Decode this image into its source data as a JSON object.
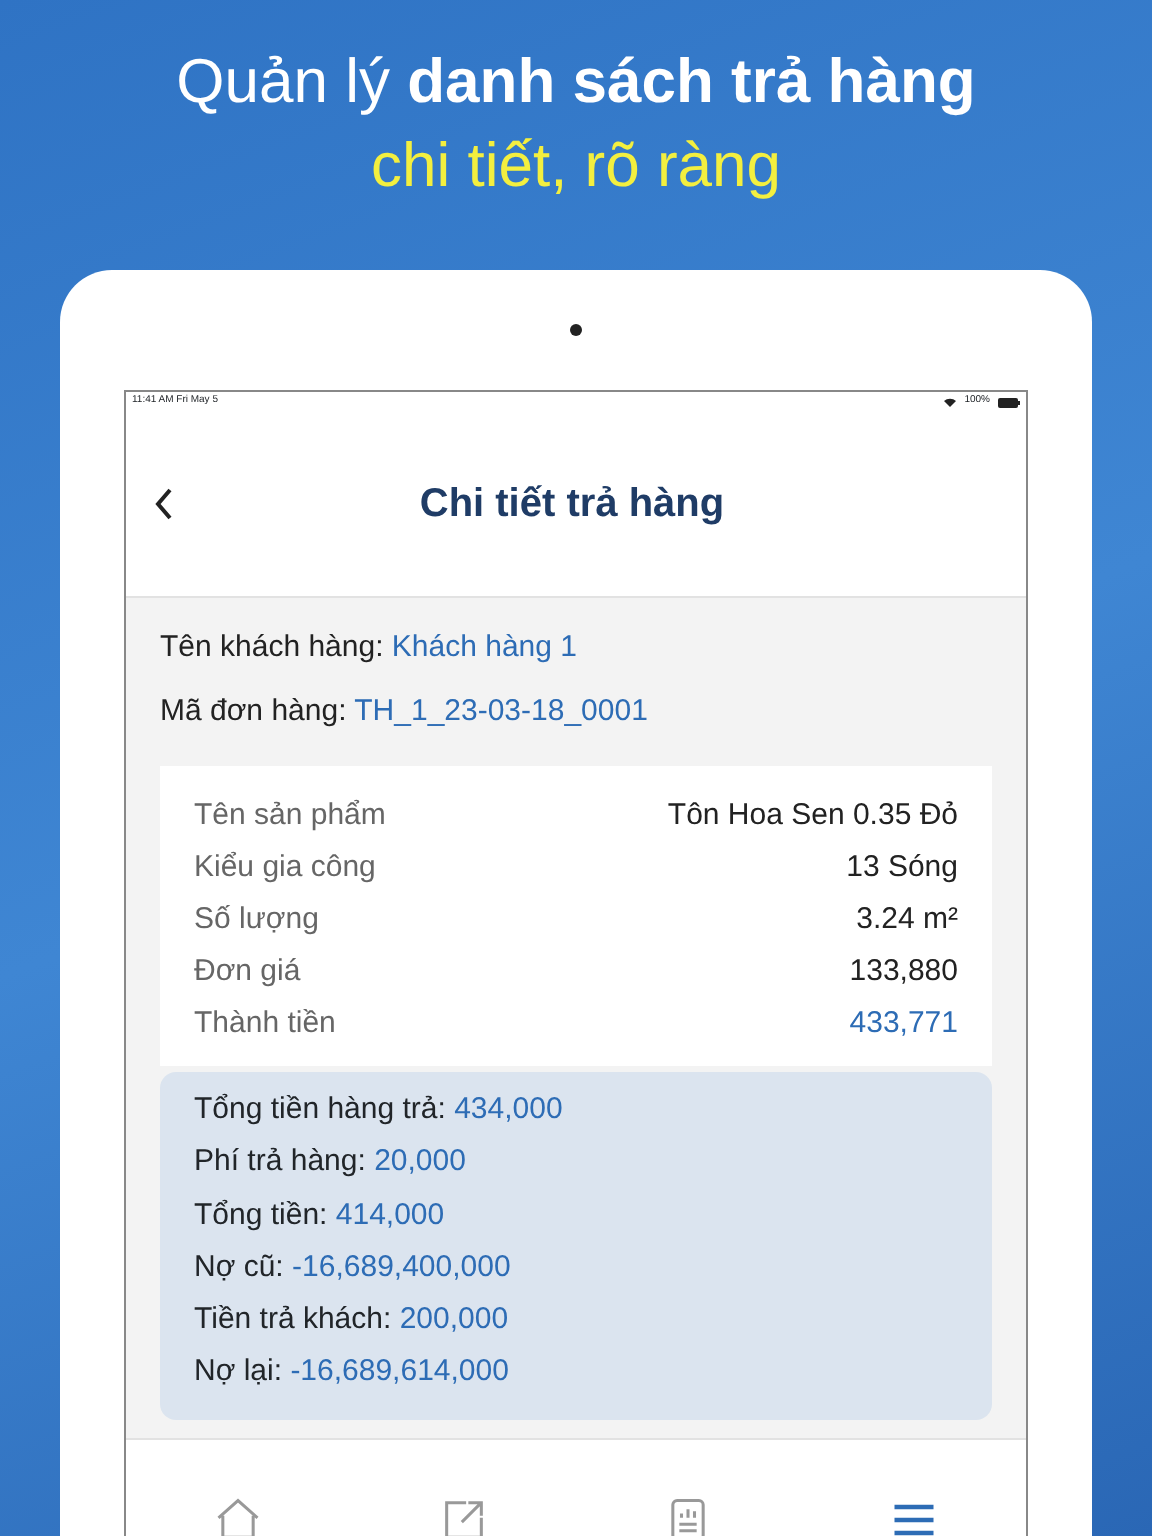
{
  "headline": {
    "line_1": "Quản lý **danh sách trả hàng**",
    "line_2": "chi tiết, rõ ràng"
  },
  "status_bar": {
    "time": "11:41 AM",
    "date": "Fri May 5",
    "battery": "100%"
  },
  "nav": {
    "title": "Chi tiết trả hàng"
  },
  "info_lines": [
    {
      "label": "Tên khách hàng:",
      "value": "Khách hàng 1"
    },
    {
      "label": "Mã đơn hàng:",
      "value": "TH_1_23-03-18_0001"
    }
  ],
  "product_rows": [
    {
      "label": "Tên sản phẩm",
      "value": "Tôn Hoa Sen 0.35 Đỏ",
      "emphasis": false
    },
    {
      "label": "Kiểu gia công",
      "value": "13 Sóng",
      "emphasis": false
    },
    {
      "label": "Số lượng",
      "value": "3.24 m²",
      "emphasis": false
    },
    {
      "label": "Đơn giá",
      "value": "133,880",
      "emphasis": false
    },
    {
      "label": "Thành tiền",
      "value": "433,771",
      "emphasis": true
    }
  ],
  "summary": [
    {
      "label": "Tổng tiền hàng trả:",
      "value": "434,000"
    },
    {
      "label": "Phí trả hàng:",
      "value": "20,000"
    },
    {
      "label": "Tổng tiền:",
      "value": "414,000"
    },
    {
      "label": "Nợ cũ:",
      "value": "-16,689,400,000"
    },
    {
      "label": "Tiền trả khách:",
      "value": "200,000"
    },
    {
      "label": "Nợ lại:",
      "value": "-16,689,614,000"
    }
  ],
  "tab_bar": [
    {
      "kind": "home",
      "selected": false
    },
    {
      "kind": "share",
      "selected": false
    },
    {
      "kind": "report",
      "selected": false
    },
    {
      "kind": "menu",
      "selected": true
    }
  ]
}
